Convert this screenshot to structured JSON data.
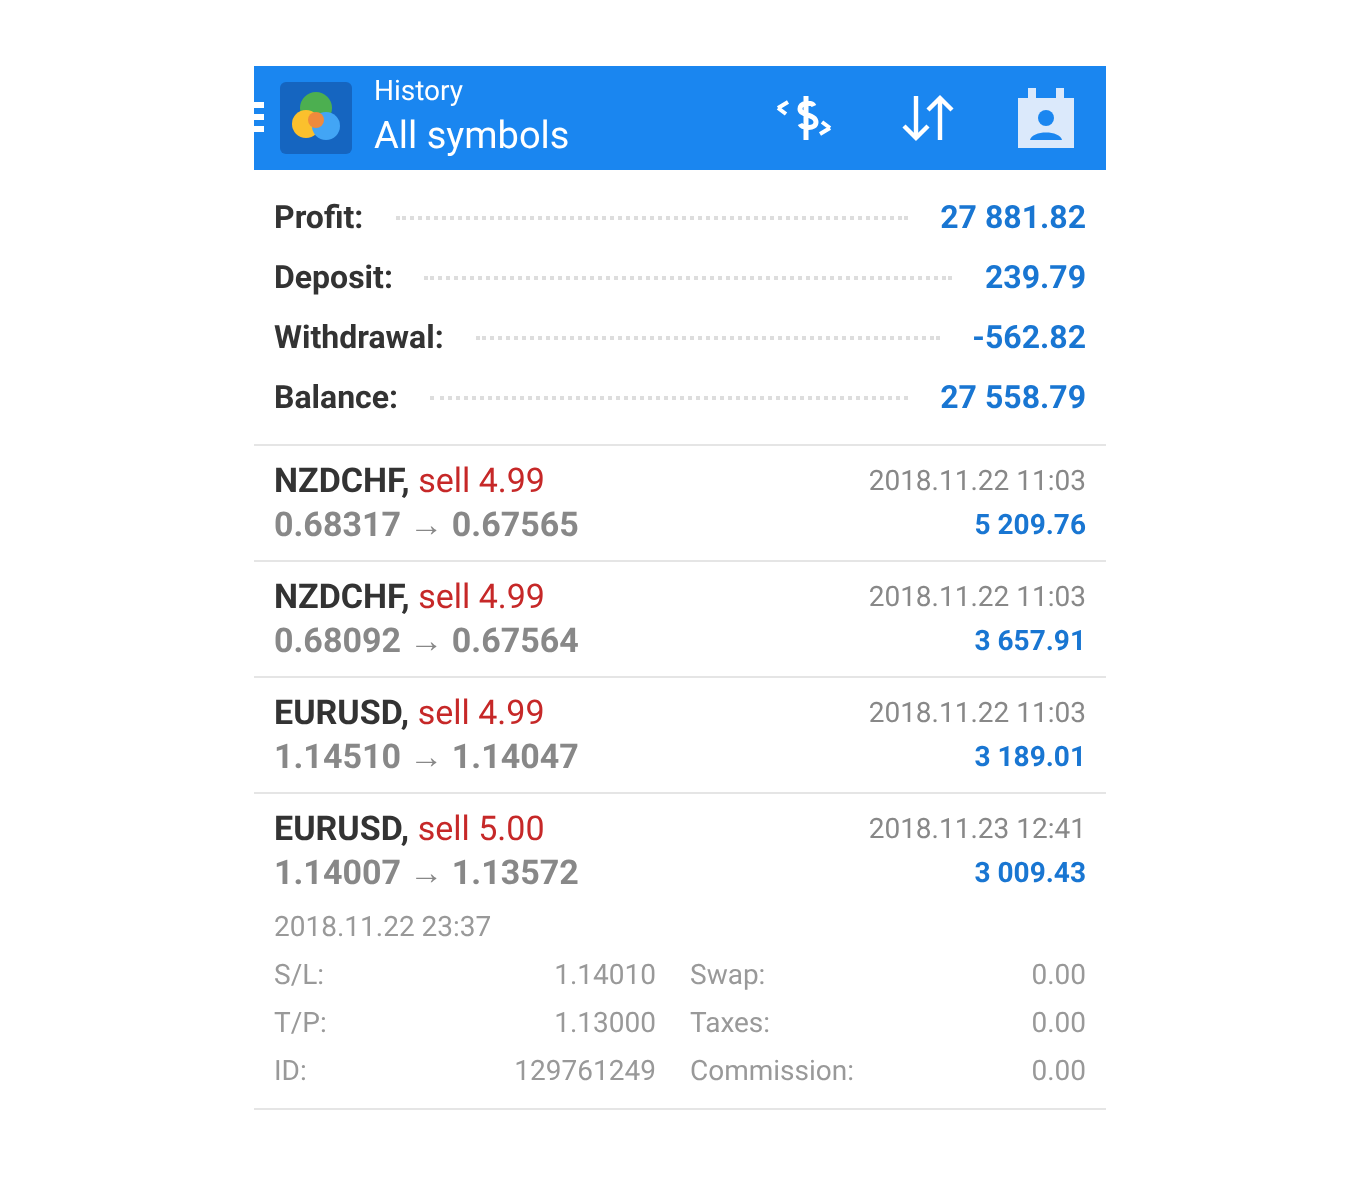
{
  "header": {
    "subtitle": "History",
    "title": "All symbols"
  },
  "summary": [
    {
      "label": "Profit:",
      "value": "27 881.82"
    },
    {
      "label": "Deposit:",
      "value": "239.79"
    },
    {
      "label": "Withdrawal:",
      "value": "-562.82"
    },
    {
      "label": "Balance:",
      "value": "27 558.79"
    }
  ],
  "deals": [
    {
      "symbol": "NZDCHF,",
      "action": "sell 4.99",
      "prices": "0.68317 → 0.67565",
      "time": "2018.11.22 11:03",
      "profit": "5 209.76"
    },
    {
      "symbol": "NZDCHF,",
      "action": "sell 4.99",
      "prices": "0.68092 → 0.67564",
      "time": "2018.11.22 11:03",
      "profit": "3 657.91"
    },
    {
      "symbol": "EURUSD,",
      "action": "sell 4.99",
      "prices": "1.14510 → 1.14047",
      "time": "2018.11.22 11:03",
      "profit": "3 189.01"
    },
    {
      "symbol": "EURUSD,",
      "action": "sell 5.00",
      "prices": "1.14007 → 1.13572",
      "time": "2018.11.23 12:41",
      "profit": "3 009.43",
      "details": {
        "open_time": "2018.11.22 23:37",
        "fields": [
          {
            "label": "S/L:",
            "value": "1.14010",
            "label2": "Swap:",
            "value2": "0.00"
          },
          {
            "label": "T/P:",
            "value": "1.13000",
            "label2": "Taxes:",
            "value2": "0.00"
          },
          {
            "label": "ID:",
            "value": "129761249",
            "label2": "Commission:",
            "value2": "0.00"
          }
        ]
      }
    }
  ]
}
